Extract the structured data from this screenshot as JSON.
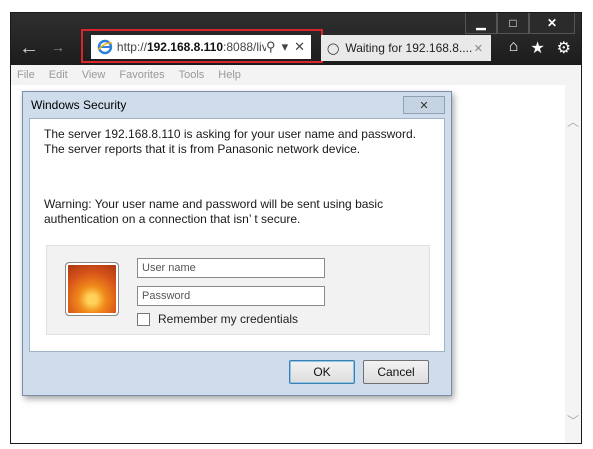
{
  "browser": {
    "address": {
      "prefix": "http://",
      "host": "192.168.8.110",
      "suffix": ":8088/liv"
    },
    "tab": {
      "title": "Waiting for 192.168.8...."
    },
    "menu": [
      "File",
      "Edit",
      "View",
      "Favorites",
      "Tools",
      "Help"
    ]
  },
  "dialog": {
    "title": "Windows Security",
    "close_label": "✕",
    "message": "The server 192.168.8.110 is asking for your user name and password. The server reports that it is from Panasonic network device.",
    "warning": "Warning: Your user name and password will be sent using basic authentication on a connection that isn’ t secure.",
    "username_placeholder": "User name",
    "password_placeholder": "Password",
    "remember_label": "Remember my credentials",
    "ok_label": "OK",
    "cancel_label": "Cancel"
  },
  "colors": {
    "highlight": "#d9262c",
    "dialog_frame": "#cfdceb",
    "ok_focus": "#3c7fb1"
  }
}
